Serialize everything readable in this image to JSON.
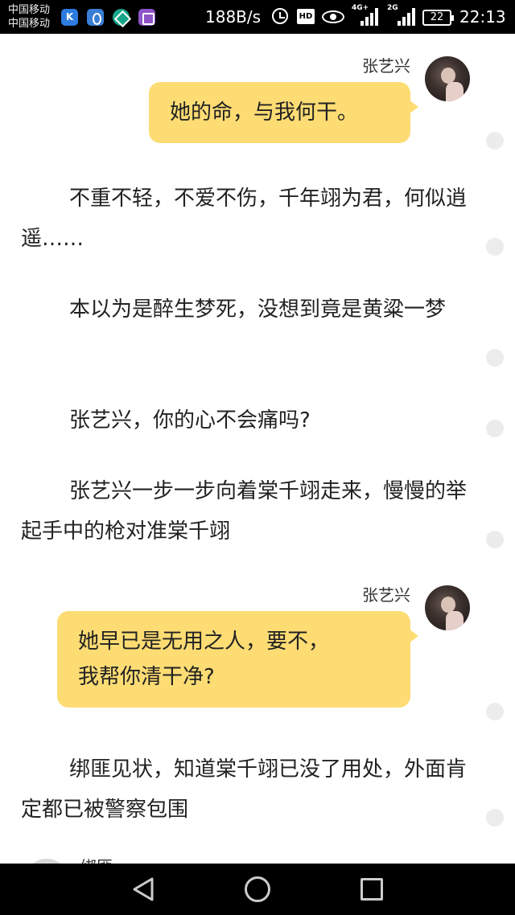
{
  "status_bar": {
    "carrier_1": "中国移动",
    "carrier_2": "中国移动",
    "app_k_label": "K",
    "network_speed": "188B/s",
    "hd_label": "HD",
    "signal_1_label": "4G+",
    "signal_2_label": "2G",
    "battery_level": "22",
    "time": "22:13",
    "icons": [
      "k-app-icon",
      "radio-app-icon",
      "green-app-icon",
      "gallery-app-icon",
      "alarm-icon",
      "hd-icon",
      "eye-comfort-icon",
      "signal-4g-icon",
      "signal-2g-icon",
      "battery-icon"
    ]
  },
  "story": {
    "speaker_name": "张艺兴",
    "bubble_1": "她的命，与我何干。",
    "para_1": "不重不轻，不爱不伤，千年翊为君，何似逍遥……",
    "para_2": "本以为是醉生梦死，没想到竟是黄粱一梦",
    "para_3": "张艺兴，你的心不会痛吗?",
    "para_4": "张艺兴一步一步向着棠千翊走来，慢慢的举起手中的枪对准棠千翊",
    "bubble_2_line_1": "她早已是无用之人，要不，",
    "bubble_2_line_2": "我帮你清干净?",
    "para_5": "绑匪见状，知道棠千翊已没了用处，外面肯定都已被警察包围",
    "partial_name": "绑匪"
  },
  "colors": {
    "bubble": "#fddc74",
    "text": "#222222",
    "comment_dot": "#ececec",
    "bars": "#000000"
  },
  "nav_bar": {
    "icons": [
      "back-icon",
      "home-icon",
      "recent-apps-icon"
    ]
  }
}
